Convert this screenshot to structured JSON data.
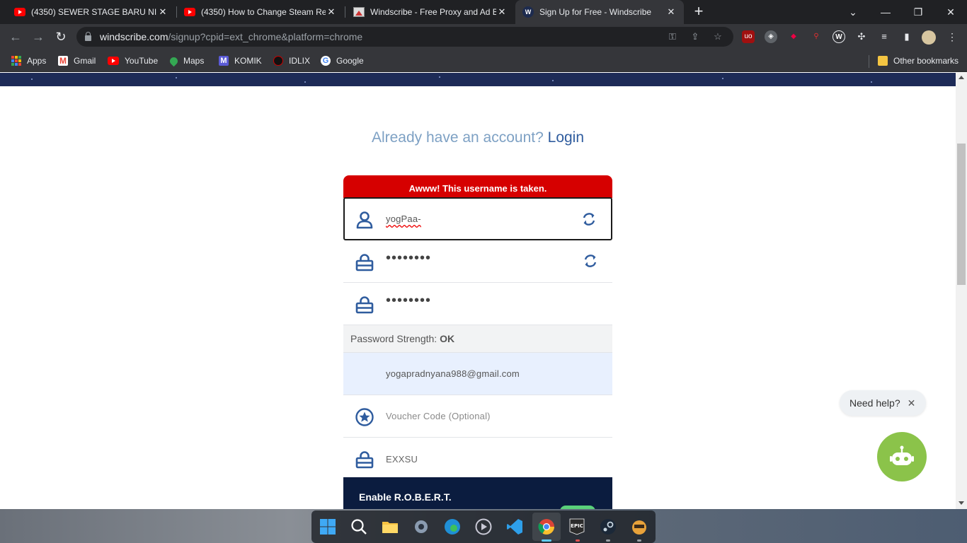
{
  "browser": {
    "tabs": [
      {
        "title": "(4350) SEWER STAGE BARU NIH !",
        "favicon": "youtube-icon",
        "active": false
      },
      {
        "title": "(4350) How to Change Steam Reg",
        "favicon": "youtube-icon",
        "active": false
      },
      {
        "title": "Windscribe - Free Proxy and Ad B",
        "favicon": "image-icon",
        "active": false
      },
      {
        "title": "Sign Up for Free - Windscribe",
        "favicon": "windscribe-icon",
        "active": true
      }
    ],
    "address": {
      "host": "windscribe.com",
      "path": "/signup?cpid=ext_chrome&platform=chrome"
    },
    "bookmarks": [
      "Apps",
      "Gmail",
      "YouTube",
      "Maps",
      "KOMIK",
      "IDLIX",
      "Google"
    ],
    "other_bookmarks": "Other bookmarks"
  },
  "page": {
    "already_text": "Already have an account?",
    "login_link": "Login",
    "error": "Awww! This username is taken.",
    "username_value": "yogPaa-",
    "password_value": "••••••••",
    "confirm_value": "••••••••",
    "strength_label": "Password Strength:",
    "strength_value": "OK",
    "email_value": "yogapradnyana988@gmail.com",
    "voucher_placeholder": "Voucher Code (Optional)",
    "captcha_value": "EXXSU",
    "robert_title": "Enable R.O.B.E.R.T."
  },
  "chat": {
    "help_text": "Need help?"
  },
  "colors": {
    "accent_blue": "#2f5c9e",
    "error_red": "#d60000",
    "bot_green": "#8bc34a"
  }
}
